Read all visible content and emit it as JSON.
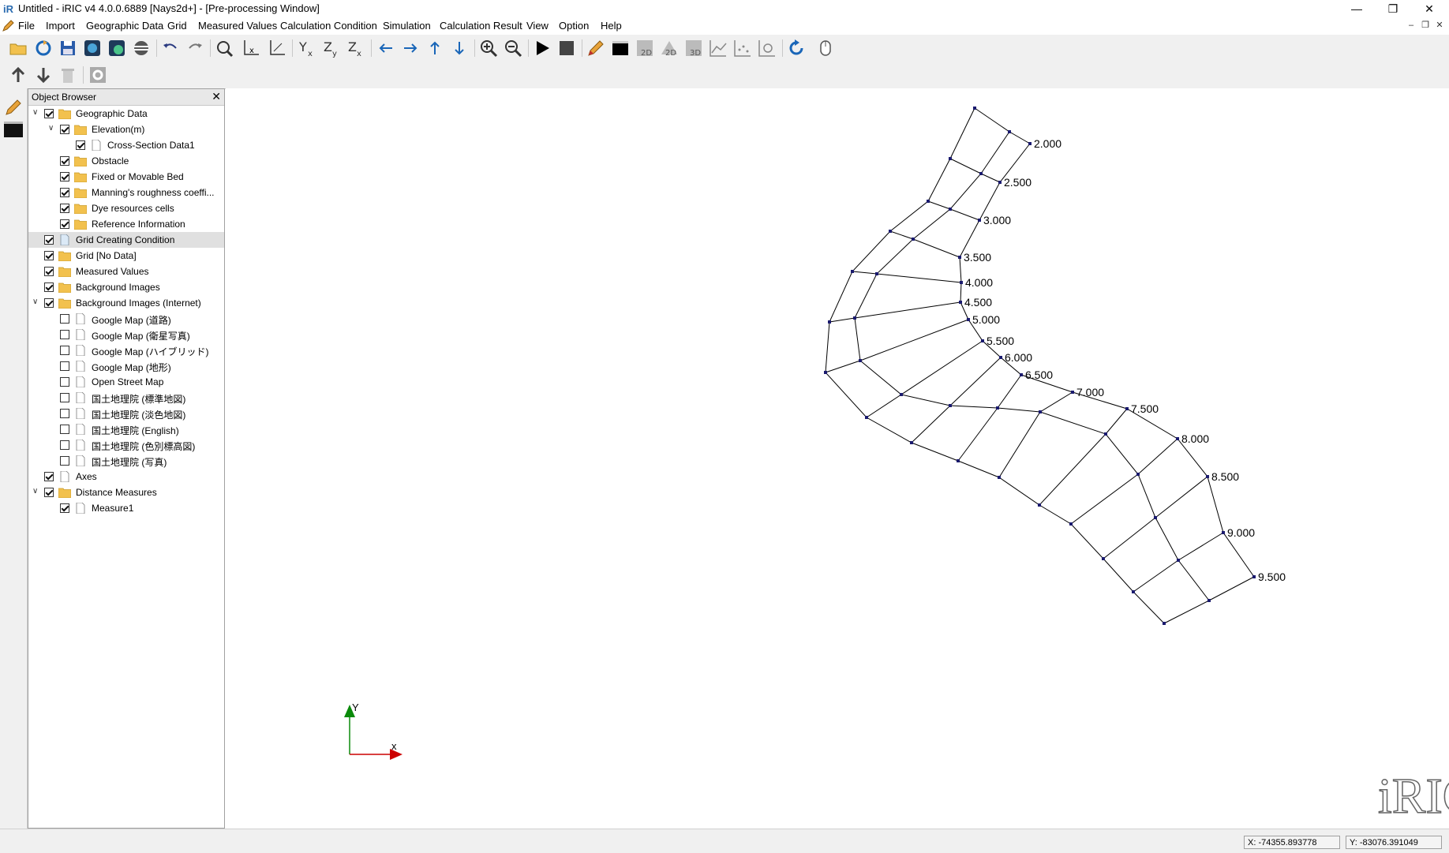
{
  "window": {
    "title": "Untitled - iRIC v4 4.0.0.6889 [Nays2d+] - [Pre-processing Window]",
    "minimize": "—",
    "restore": "❐",
    "close": "✕"
  },
  "menu": [
    "File",
    "Import",
    "Geographic Data",
    "Grid",
    "Measured Values",
    "Calculation Condition",
    "Simulation",
    "Calculation Result",
    "View",
    "Option",
    "Help"
  ],
  "object_browser": {
    "title": "Object Browser",
    "close": "✕",
    "items": [
      {
        "label": "Geographic Data",
        "level": 0,
        "expand": "open",
        "checked": true,
        "icon": "folder-icon"
      },
      {
        "label": "Elevation(m)",
        "level": 1,
        "expand": "open",
        "checked": true,
        "icon": "folder-icon"
      },
      {
        "label": "Cross-Section Data1",
        "level": 2,
        "expand": "",
        "checked": true,
        "icon": "file-icon"
      },
      {
        "label": "Obstacle",
        "level": 1,
        "expand": "",
        "checked": true,
        "icon": "folder-icon"
      },
      {
        "label": "Fixed or Movable Bed",
        "level": 1,
        "expand": "",
        "checked": true,
        "icon": "folder-icon"
      },
      {
        "label": "Manning's roughness coeffi...",
        "level": 1,
        "expand": "",
        "checked": true,
        "icon": "folder-icon"
      },
      {
        "label": "Dye resources cells",
        "level": 1,
        "expand": "",
        "checked": true,
        "icon": "folder-icon"
      },
      {
        "label": "Reference Information",
        "level": 1,
        "expand": "",
        "checked": true,
        "icon": "folder-icon"
      },
      {
        "label": "Grid Creating Condition",
        "level": 0,
        "expand": "",
        "checked": true,
        "icon": "file-blue-icon",
        "selected": true
      },
      {
        "label": "Grid [No Data]",
        "level": 0,
        "expand": "",
        "checked": true,
        "icon": "folder-icon"
      },
      {
        "label": "Measured Values",
        "level": 0,
        "expand": "",
        "checked": true,
        "icon": "folder-icon"
      },
      {
        "label": "Background Images",
        "level": 0,
        "expand": "",
        "checked": true,
        "icon": "folder-icon"
      },
      {
        "label": "Background Images (Internet)",
        "level": 0,
        "expand": "open",
        "checked": true,
        "icon": "folder-icon"
      },
      {
        "label": "Google Map (道路)",
        "level": 1,
        "expand": "",
        "checked": false,
        "icon": "file-icon"
      },
      {
        "label": "Google Map (衛星写真)",
        "level": 1,
        "expand": "",
        "checked": false,
        "icon": "file-icon"
      },
      {
        "label": "Google Map (ハイブリッド)",
        "level": 1,
        "expand": "",
        "checked": false,
        "icon": "file-icon"
      },
      {
        "label": "Google Map (地形)",
        "level": 1,
        "expand": "",
        "checked": false,
        "icon": "file-icon"
      },
      {
        "label": "Open Street Map",
        "level": 1,
        "expand": "",
        "checked": false,
        "icon": "file-icon"
      },
      {
        "label": "国土地理院 (標準地図)",
        "level": 1,
        "expand": "",
        "checked": false,
        "icon": "file-icon"
      },
      {
        "label": "国土地理院 (淡色地図)",
        "level": 1,
        "expand": "",
        "checked": false,
        "icon": "file-icon"
      },
      {
        "label": "国土地理院 (English)",
        "level": 1,
        "expand": "",
        "checked": false,
        "icon": "file-icon"
      },
      {
        "label": "国土地理院 (色別標高図)",
        "level": 1,
        "expand": "",
        "checked": false,
        "icon": "file-icon"
      },
      {
        "label": "国土地理院 (写真)",
        "level": 1,
        "expand": "",
        "checked": false,
        "icon": "file-icon"
      },
      {
        "label": "Axes",
        "level": 0,
        "expand": "",
        "checked": true,
        "icon": "file-icon"
      },
      {
        "label": "Distance Measures",
        "level": 0,
        "expand": "open",
        "checked": true,
        "icon": "folder-icon"
      },
      {
        "label": "Measure1",
        "level": 1,
        "expand": "",
        "checked": true,
        "icon": "file-icon"
      }
    ]
  },
  "canvas": {
    "cross_sections": [
      {
        "label": "2.000",
        "pts": [
          [
            949,
            25
          ],
          [
            993,
            55
          ],
          [
            1019,
            70
          ]
        ]
      },
      {
        "label": "2.500",
        "pts": [
          [
            918,
            89
          ],
          [
            957,
            108
          ],
          [
            981,
            119
          ]
        ]
      },
      {
        "label": "3.000",
        "pts": [
          [
            890,
            143
          ],
          [
            918,
            153
          ],
          [
            955,
            167
          ]
        ]
      },
      {
        "label": "3.500",
        "pts": [
          [
            842,
            181
          ],
          [
            871,
            191
          ],
          [
            930,
            214
          ]
        ]
      },
      {
        "label": "4.000",
        "pts": [
          [
            794,
            232
          ],
          [
            825,
            235
          ],
          [
            932,
            246
          ]
        ]
      },
      {
        "label": "4.500",
        "pts": [
          [
            765,
            296
          ],
          [
            797,
            291
          ],
          [
            931,
            271
          ]
        ]
      },
      {
        "label": "5.000",
        "pts": [
          [
            760,
            360
          ],
          [
            804,
            345
          ],
          [
            941,
            293
          ]
        ]
      },
      {
        "label": "5.500",
        "pts": [
          [
            812,
            417
          ],
          [
            856,
            388
          ],
          [
            959,
            320
          ]
        ]
      },
      {
        "label": "6.000",
        "pts": [
          [
            869,
            449
          ],
          [
            918,
            402
          ],
          [
            982,
            341
          ]
        ]
      },
      {
        "label": "6.500",
        "pts": [
          [
            928,
            472
          ],
          [
            978,
            405
          ],
          [
            1008,
            363
          ]
        ]
      },
      {
        "label": "7.000",
        "pts": [
          [
            980,
            493
          ],
          [
            1032,
            410
          ],
          [
            1073,
            385
          ]
        ]
      },
      {
        "label": "7.500",
        "pts": [
          [
            1031,
            528
          ],
          [
            1115,
            438
          ],
          [
            1142,
            406
          ]
        ]
      },
      {
        "label": "8.000",
        "pts": [
          [
            1071,
            552
          ],
          [
            1156,
            489
          ],
          [
            1206,
            444
          ]
        ]
      },
      {
        "label": "8.500",
        "pts": [
          [
            1112,
            596
          ],
          [
            1178,
            544
          ],
          [
            1244,
            492
          ]
        ]
      },
      {
        "label": "9.000",
        "pts": [
          [
            1150,
            638
          ],
          [
            1207,
            598
          ],
          [
            1264,
            563
          ]
        ]
      },
      {
        "label": "9.500",
        "pts": [
          [
            1189,
            678
          ],
          [
            1246,
            649
          ],
          [
            1303,
            619
          ]
        ]
      }
    ],
    "extra_chain": [
      [
        1203,
        675
      ],
      [
        1247,
        649
      ],
      [
        1303,
        619
      ]
    ],
    "axes": {
      "x": "x",
      "y": "Y"
    },
    "logo_text": "iRIC"
  },
  "status": {
    "x": "X: -74355.893778",
    "y": "Y: -83076.391049"
  },
  "colors": {
    "node": "#1a1a6e",
    "line": "#000000",
    "axis_x": "#cc0000",
    "axis_y": "#0a8a0a",
    "folder": "#f2c14e"
  }
}
